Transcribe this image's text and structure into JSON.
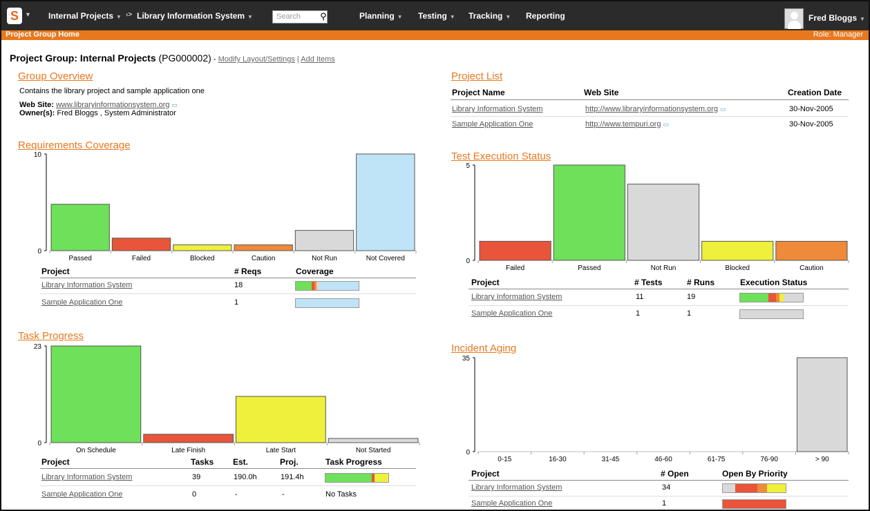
{
  "header": {
    "logo_letter": "S",
    "project_group": "Internal Projects",
    "project": "Library Information System",
    "search_placeholder": "Search",
    "nav": [
      "Planning",
      "Testing",
      "Tracking",
      "Reporting"
    ],
    "user_name": "Fred Bloggs"
  },
  "subbar": {
    "left": "Project Group Home",
    "right": "Role: Manager"
  },
  "page": {
    "title_prefix": "Project Group:",
    "title_name": "Internal Projects",
    "title_code": "(PG000002)",
    "sep": " - ",
    "modify_link": "Modify Layout/Settings",
    "pipe": " | ",
    "add_link": "Add Items"
  },
  "overview": {
    "heading": "Group Overview",
    "description": "Contains the library project and sample application one",
    "website_label": "Web Site:",
    "website": "www.libraryinformationsystem.org",
    "owners_label": "Owner(s):",
    "owners": "Fred Bloggs , System Administrator"
  },
  "requirements": {
    "heading": "Requirements Coverage",
    "cols": [
      "Project",
      "# Reqs",
      "Coverage"
    ],
    "rows": [
      {
        "project": "Library Information System",
        "reqs": "18"
      },
      {
        "project": "Sample Application One",
        "reqs": "1"
      }
    ]
  },
  "tasks": {
    "heading": "Task Progress",
    "cols": [
      "Project",
      "Tasks",
      "Est.",
      "Proj.",
      "Task Progress"
    ],
    "rows": [
      {
        "project": "Library Information System",
        "tasks": "39",
        "est": "190.0h",
        "proj": "191.4h",
        "progress": ""
      },
      {
        "project": "Sample Application One",
        "tasks": "0",
        "est": "-",
        "proj": "-",
        "progress": "No Tasks"
      }
    ]
  },
  "projects": {
    "heading": "Project List",
    "cols": [
      "Project Name",
      "Web Site",
      "Creation Date"
    ],
    "rows": [
      {
        "name": "Library Information System",
        "site": "http://www.libraryinformationsystem.org",
        "date": "30-Nov-2005"
      },
      {
        "name": "Sample Application One",
        "site": "http://www.tempuri.org",
        "date": "30-Nov-2005"
      }
    ]
  },
  "tests": {
    "heading": "Test Execution Status",
    "cols": [
      "Project",
      "# Tests",
      "# Runs",
      "Execution Status"
    ],
    "rows": [
      {
        "project": "Library Information System",
        "tests": "11",
        "runs": "19"
      },
      {
        "project": "Sample Application One",
        "tests": "1",
        "runs": "1"
      }
    ]
  },
  "incidents": {
    "heading": "Incident Aging",
    "cols": [
      "Project",
      "# Open",
      "Open By Priority"
    ],
    "rows": [
      {
        "project": "Library Information System",
        "open": "34"
      },
      {
        "project": "Sample Application One",
        "open": "1"
      }
    ]
  },
  "colors": {
    "accent": "#e8781e",
    "passed": "#6ee05a",
    "failed": "#e8553a",
    "blocked": "#eef03c",
    "caution": "#ee8a3a",
    "notrun": "#d9d9d9",
    "notcovered": "#bfe3f7"
  },
  "chart_data": [
    {
      "type": "bar",
      "id": "req",
      "categories": [
        "Passed",
        "Failed",
        "Blocked",
        "Caution",
        "Not Run",
        "Not Covered"
      ],
      "values": [
        4.8,
        1.3,
        0.6,
        0.6,
        2.1,
        10
      ],
      "ylim": [
        0,
        10
      ],
      "yticks": [
        "0",
        "10"
      ],
      "colors": [
        "#6ee05a",
        "#e8553a",
        "#eef03c",
        "#ee8a3a",
        "#d9d9d9",
        "#bfe3f7"
      ]
    },
    {
      "type": "bar",
      "id": "task",
      "categories": [
        "On Schedule",
        "Late Finish",
        "Late Start",
        "Not Started"
      ],
      "values": [
        23,
        2,
        11,
        1
      ],
      "ylim": [
        0,
        23
      ],
      "yticks": [
        "0",
        "23"
      ],
      "colors": [
        "#6ee05a",
        "#e8553a",
        "#eef03c",
        "#d9d9d9"
      ]
    },
    {
      "type": "bar",
      "id": "test",
      "categories": [
        "Failed",
        "Passed",
        "Not Run",
        "Blocked",
        "Caution"
      ],
      "values": [
        1,
        5,
        4,
        1,
        1
      ],
      "ylim": [
        0,
        5
      ],
      "yticks": [
        "0",
        "5"
      ],
      "colors": [
        "#e8553a",
        "#6ee05a",
        "#d9d9d9",
        "#eef03c",
        "#ee8a3a"
      ]
    },
    {
      "type": "bar",
      "id": "inc",
      "categories": [
        "0-15",
        "16-30",
        "31-45",
        "46-60",
        "61-75",
        "76-90",
        "> 90"
      ],
      "values": [
        0,
        0,
        0,
        0,
        0,
        0,
        35
      ],
      "ylim": [
        0,
        35
      ],
      "yticks": [
        "0",
        "35"
      ],
      "colors": [
        "#d9d9d9",
        "#d9d9d9",
        "#d9d9d9",
        "#d9d9d9",
        "#d9d9d9",
        "#d9d9d9",
        "#d9d9d9"
      ]
    }
  ],
  "mini_bars": {
    "req_1": [
      [
        "#6ee05a",
        0.25
      ],
      [
        "#e8553a",
        0.05
      ],
      [
        "#ee8a3a",
        0.03
      ],
      [
        "#d9d9d9",
        0.06
      ],
      [
        "#bfe3f7",
        0.61
      ]
    ],
    "req_2": [
      [
        "#bfe3f7",
        1.0
      ]
    ],
    "test_1": [
      [
        "#6ee05a",
        0.45
      ],
      [
        "#e8553a",
        0.12
      ],
      [
        "#ee8a3a",
        0.06
      ],
      [
        "#eef03c",
        0.06
      ],
      [
        "#d9d9d9",
        0.31
      ]
    ],
    "test_2": [
      [
        "#d9d9d9",
        1.0
      ]
    ],
    "task_1": [
      [
        "#6ee05a",
        0.74
      ],
      [
        "#e8553a",
        0.04
      ],
      [
        "#eef03c",
        0.22
      ]
    ],
    "inc_1": [
      [
        "#d9d9d9",
        0.2
      ],
      [
        "#e8553a",
        0.35
      ],
      [
        "#ee8a3a",
        0.15
      ],
      [
        "#eef03c",
        0.3
      ]
    ],
    "inc_2": [
      [
        "#e8553a",
        1.0
      ]
    ]
  }
}
